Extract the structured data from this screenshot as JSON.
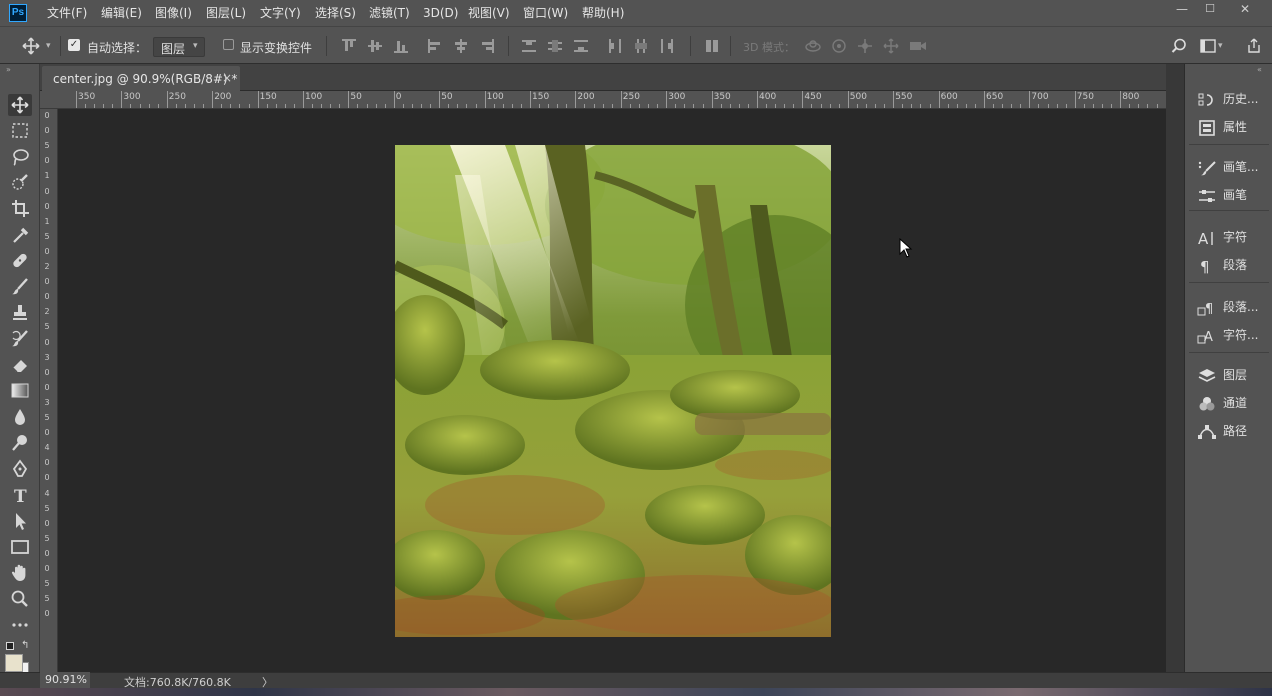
{
  "app": {
    "logo_text": "Ps"
  },
  "menu": [
    "文件(F)",
    "编辑(E)",
    "图像(I)",
    "图层(L)",
    "文字(Y)",
    "选择(S)",
    "滤镜(T)",
    "3D(D)",
    "视图(V)",
    "窗口(W)",
    "帮助(H)"
  ],
  "window_controls": {
    "minimize": "—",
    "maximize": "☐",
    "close": "✕"
  },
  "options": {
    "auto_select_label": "自动选择：",
    "auto_select_checked": true,
    "auto_select_target": "图层",
    "show_transform_label": "显示变换控件",
    "show_transform_checked": false,
    "mode_3d_label": "3D 模式："
  },
  "document_tab": {
    "title": "center.jpg @ 90.9%(RGB/8#) *",
    "close": "×"
  },
  "ruler_h": [
    "350",
    "300",
    "250",
    "200",
    "150",
    "100",
    "50",
    "0",
    "50",
    "100",
    "150",
    "200",
    "250",
    "300",
    "350",
    "400",
    "450",
    "500",
    "550",
    "600",
    "650",
    "700",
    "750",
    "800"
  ],
  "ruler_v": [
    "0",
    "0",
    "5",
    "0",
    "1",
    "0",
    "0",
    "1",
    "5",
    "0",
    "2",
    "0",
    "0",
    "2",
    "5",
    "0",
    "3",
    "0",
    "0",
    "3",
    "5",
    "0",
    "4",
    "0",
    "0",
    "4",
    "5",
    "0",
    "5",
    "0",
    "0",
    "5",
    "5",
    "0"
  ],
  "panels": [
    {
      "label": "历史...",
      "icon": "history-icon"
    },
    {
      "label": "属性",
      "icon": "properties-icon"
    },
    {
      "label": "画笔...",
      "icon": "brush-presets-icon"
    },
    {
      "label": "画笔",
      "icon": "brush-settings-icon"
    },
    {
      "label": "字符",
      "icon": "character-icon"
    },
    {
      "label": "段落",
      "icon": "paragraph-icon"
    },
    {
      "label": "段落...",
      "icon": "paragraph-styles-icon"
    },
    {
      "label": "字符...",
      "icon": "character-styles-icon"
    },
    {
      "label": "图层",
      "icon": "layers-icon"
    },
    {
      "label": "通道",
      "icon": "channels-icon"
    },
    {
      "label": "路径",
      "icon": "paths-icon"
    }
  ],
  "status": {
    "zoom": "90.91%",
    "doc_info": "文档:760.8K/760.8K",
    "arrow": "〉"
  },
  "colors": {
    "foreground": "#e8e2cc",
    "background": "#f2f2f2"
  }
}
